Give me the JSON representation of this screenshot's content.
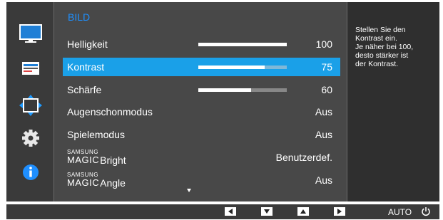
{
  "menu": {
    "title": "BILD",
    "items": [
      {
        "label": "Helligkeit",
        "value": "100",
        "slider": 1.0
      },
      {
        "label": "Kontrast",
        "value": "75",
        "slider": 0.75,
        "selected": true
      },
      {
        "label": "Schärfe",
        "value": "60",
        "slider": 0.6
      },
      {
        "label": "Augenschonmodus",
        "value": "Aus"
      },
      {
        "label": "Spielemodus",
        "value": "Aus"
      },
      {
        "label_brand_top": "SAMSUNG",
        "label_brand_bottom": "MAGIC",
        "label": "Bright",
        "value": "Benutzerdef."
      },
      {
        "label_brand_top": "SAMSUNG",
        "label_brand_bottom": "MAGIC",
        "label": "Angle",
        "value": "Aus"
      }
    ]
  },
  "help": {
    "text": "Stellen Sie den\nKontrast ein.\nJe näher bei 100,\ndesto stärker ist\nder Kontrast."
  },
  "sidebar": {
    "icons": [
      "monitor-icon",
      "onscreen-display-icon",
      "position-arrows-icon",
      "settings-gear-icon",
      "info-icon"
    ]
  },
  "bottom_bar": {
    "buttons": [
      "left-arrow-icon",
      "down-arrow-icon",
      "up-arrow-icon",
      "right-arrow-icon"
    ],
    "auto_label": "AUTO",
    "power_icon": "power-icon"
  },
  "colors": {
    "accent": "#1aa0e8",
    "title": "#1e90ff",
    "panel": "#484848",
    "background": "#3a3a3a"
  }
}
